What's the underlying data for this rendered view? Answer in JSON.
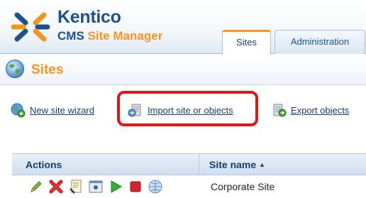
{
  "brand": {
    "name": "Kentico",
    "sub_cms": "CMS",
    "sub_site_manager": "Site Manager"
  },
  "tabs": [
    {
      "label": "Sites"
    },
    {
      "label": "Administration"
    }
  ],
  "page": {
    "title": "Sites"
  },
  "actions": {
    "new_site_wizard": "New site wizard",
    "import_site": "Import site or objects",
    "export_objects": "Export objects"
  },
  "grid": {
    "headers": {
      "actions": "Actions",
      "site_name": "Site name"
    },
    "sort_indicator": "▲",
    "rows": [
      {
        "site_name": "Corporate Site"
      }
    ]
  },
  "colors": {
    "accent": "#f7941d",
    "brand_blue": "#1f4f8d",
    "highlight": "#e01616"
  },
  "icons": [
    "kentico-logo-icon",
    "globe-icon",
    "new-site-wizard-icon",
    "import-icon",
    "export-icon",
    "edit-icon",
    "delete-icon",
    "properties-icon",
    "preview-icon",
    "start-icon",
    "stop-icon",
    "live-site-icon"
  ]
}
